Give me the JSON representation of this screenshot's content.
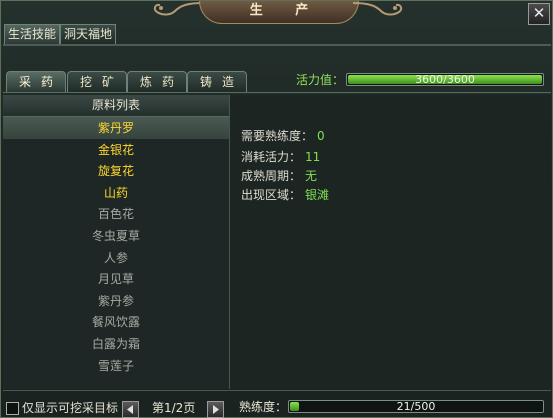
{
  "window": {
    "title": "生 产",
    "close_icon": "✕"
  },
  "top_tabs": [
    {
      "label": "生活技能",
      "active": true
    },
    {
      "label": "洞天福地",
      "active": false
    }
  ],
  "sub_tabs": [
    {
      "label": "采药",
      "active": true
    },
    {
      "label": "挖矿",
      "active": false
    },
    {
      "label": "炼药",
      "active": false
    },
    {
      "label": "铸造",
      "active": false
    }
  ],
  "vitality": {
    "label": "活力值：",
    "text": "3600/3600",
    "current": 3600,
    "max": 3600
  },
  "list": {
    "header": "原料列表",
    "items": [
      {
        "name": "紫丹罗",
        "available": true,
        "selected": true
      },
      {
        "name": "金银花",
        "available": true,
        "selected": false
      },
      {
        "name": "旋复花",
        "available": true,
        "selected": false
      },
      {
        "name": "山药",
        "available": true,
        "selected": false
      },
      {
        "name": "百色花",
        "available": false,
        "selected": false
      },
      {
        "name": "冬虫夏草",
        "available": false,
        "selected": false
      },
      {
        "name": "人参",
        "available": false,
        "selected": false
      },
      {
        "name": "月见草",
        "available": false,
        "selected": false
      },
      {
        "name": "紫丹参",
        "available": false,
        "selected": false
      },
      {
        "name": "餐风饮露",
        "available": false,
        "selected": false
      },
      {
        "name": "白露为霜",
        "available": false,
        "selected": false
      },
      {
        "name": "雪莲子",
        "available": false,
        "selected": false
      }
    ]
  },
  "details": {
    "required_proficiency": {
      "label": "需要熟练度：",
      "value": "0"
    },
    "vitality_cost": {
      "label": "消耗活力：",
      "value": "11"
    },
    "maturity_period": {
      "label": "成熟周期：",
      "value": "无"
    },
    "region": {
      "label": "出现区域：",
      "value": "银滩"
    }
  },
  "footer": {
    "filter_label": "仅显示可挖采目标",
    "filter_checked": false,
    "page_text": "第1/2页",
    "current_page": 1,
    "total_pages": 2,
    "proficiency_label": "熟练度：",
    "proficiency_text": "21/500",
    "proficiency_current": 21,
    "proficiency_max": 500
  },
  "colors": {
    "available": "#ffd92e",
    "unavailable": "#a7aaa3",
    "value_green": "#7fe052",
    "bar_green": "#8de34d"
  }
}
